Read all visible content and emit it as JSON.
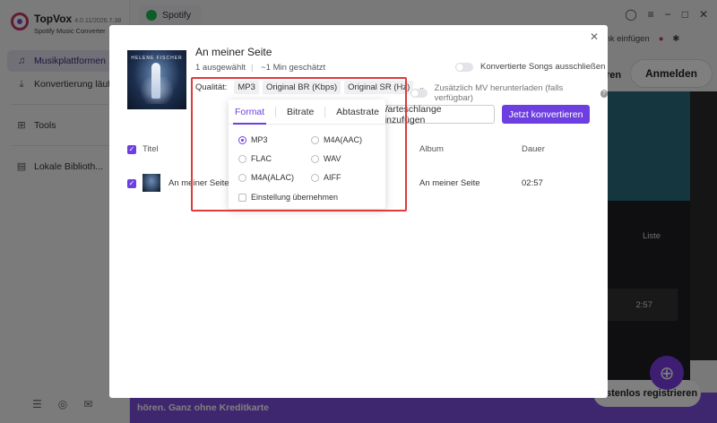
{
  "app": {
    "name": "TopVox",
    "version": "4.0.11/2026.7.38",
    "subtitle": "Spotify Music Converter"
  },
  "sidebar": {
    "items": [
      {
        "label": "Musikplattformen",
        "icon": "music-note-icon"
      },
      {
        "label": "Konvertierung läuft",
        "icon": "download-icon"
      },
      {
        "label": "Tools",
        "icon": "tools-grid-icon"
      },
      {
        "label": "Lokale Biblioth...",
        "icon": "library-icon"
      }
    ]
  },
  "topbar": {
    "tab_label": "Spotify",
    "link_label": "+ Link einfügen"
  },
  "background": {
    "login_button": "Anmelden",
    "ren_text": "ren",
    "list_label": "Liste",
    "row_duration": "2:57",
    "banner_text": "hören. Ganz ohne Kreditkarte",
    "register_button": "stenlos registrieren"
  },
  "modal": {
    "title": "An meiner Seite",
    "selected": "1 ausgewählt",
    "estimate": "~1 Min geschätzt",
    "cover_text": "HELENE FISCHER",
    "exclude_option": "Konvertierte Songs ausschließen",
    "mv_option": "Zusätzlich MV herunterladen (falls verfügbar)",
    "quality": {
      "label": "Qualität:",
      "format": "MP3",
      "bitrate": "Original BR (Kbps)",
      "samplerate": "Original SR (Hz)"
    },
    "queue_button": "Warteschlange hinzufügen",
    "convert_button": "Jetzt konvertieren",
    "table": {
      "headers": {
        "title": "Titel",
        "album": "Album",
        "duration": "Dauer"
      },
      "rows": [
        {
          "title": "An meiner Seite",
          "album": "An meiner Seite",
          "duration": "02:57"
        }
      ]
    }
  },
  "dropdown": {
    "tabs": [
      "Format",
      "Bitrate",
      "Abtastrate"
    ],
    "active_tab": "Format",
    "options": [
      {
        "label": "MP3",
        "selected": true
      },
      {
        "label": "M4A(AAC)",
        "selected": false
      },
      {
        "label": "FLAC",
        "selected": false
      },
      {
        "label": "WAV",
        "selected": false
      },
      {
        "label": "M4A(ALAC)",
        "selected": false
      },
      {
        "label": "AIFF",
        "selected": false
      }
    ],
    "apply_label": "Einstellung übernehmen"
  },
  "colors": {
    "accent": "#6e3fe0",
    "highlight_frame": "#e03a3a"
  }
}
